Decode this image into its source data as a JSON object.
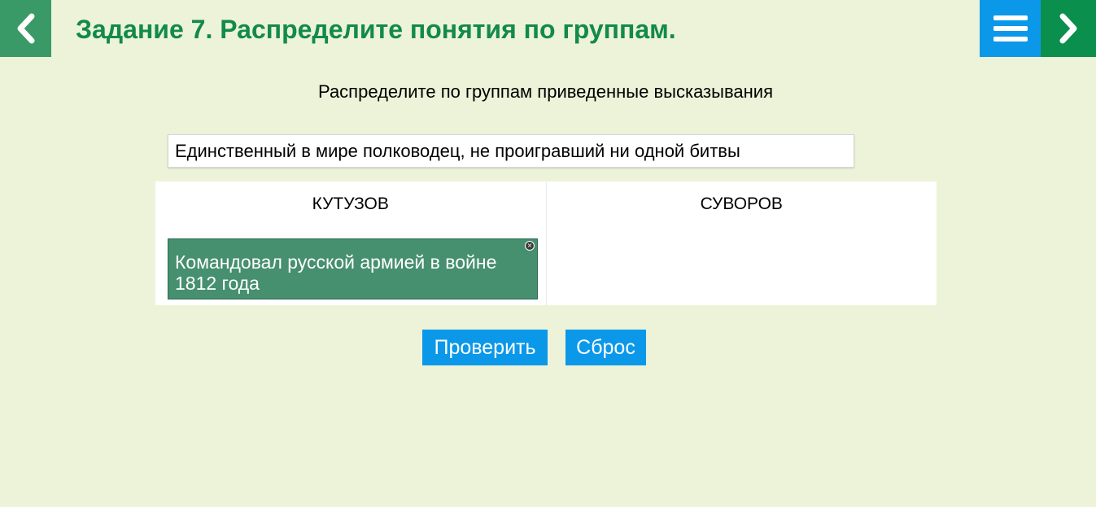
{
  "header": {
    "title": "Задание 7. Распределите понятия по группам.",
    "prev_icon": "chevron-left-icon",
    "menu_icon": "hamburger-menu-icon",
    "next_icon": "chevron-right-icon"
  },
  "task": {
    "instruction": "Распределите по группам приведенные высказывания",
    "pending_card": "Единственный в мире полководец, не проигравший ни одной битвы"
  },
  "groups": [
    {
      "title": "КУТУЗОВ",
      "items": [
        "Командовал русской армией в войне 1812 года"
      ]
    },
    {
      "title": "СУВОРОВ",
      "items": []
    }
  ],
  "actions": {
    "check_label": "Проверить",
    "reset_label": "Сброс"
  },
  "colors": {
    "background": "#edf3d8",
    "title": "#128a4b",
    "prev_button": "#3a9a67",
    "menu_button": "#0b98e9",
    "next_button": "#0a8f4d",
    "placed_card": "#468f6f",
    "action_button": "#0b98e9"
  }
}
